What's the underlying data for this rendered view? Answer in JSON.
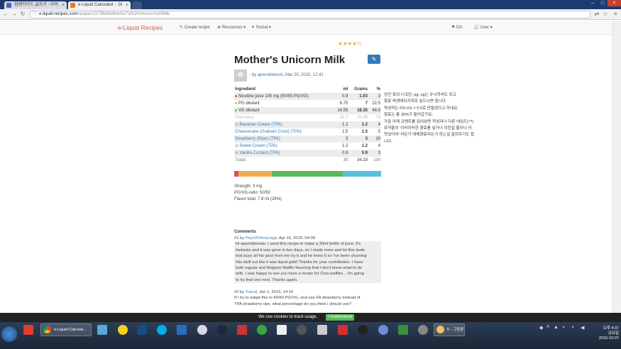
{
  "browser": {
    "tabs": [
      {
        "label": "힘쌘가이드 글쓰기 : 아이"
      },
      {
        "label": "e-Liquid Calculator :: Di"
      }
    ],
    "url_host": "e-liquid-recipes.com",
    "url_path": "/recipe/121795/Mother%27s%20Unicorn%20Milk"
  },
  "site": {
    "brand": "e-Liquid Recipes",
    "nav": {
      "create": "Create recipe",
      "resources": "Resources",
      "social": "Social",
      "da": "DA",
      "user": "User"
    }
  },
  "recipe": {
    "rating_stars": "★★★★½",
    "title": "Mother's Unicorn Milk",
    "byline_prefix": "- by",
    "author": "apwroblewski",
    "date": ", Mar 20, 2015, 12:41",
    "table": {
      "headers": {
        "ingredient": "Ingredient",
        "ml": "ml",
        "grams": "Grams",
        "pct": "%"
      },
      "base": [
        {
          "name": "Nicotine juice 100 mg (50/50 PG/VG)",
          "ml": "0.9",
          "g": "1.03",
          "pct": "3",
          "color": "#d9534f"
        },
        {
          "name": "PG dilutant",
          "ml": "6.75",
          "g": "7",
          "pct": "22.5",
          "color": "#f0ad4e"
        },
        {
          "name": "VG dilutant",
          "ml": "14.55",
          "g": "18.35",
          "pct": "48.5",
          "color": "#5cb85c"
        }
      ],
      "base_total": {
        "name": "Total base",
        "ml": "22.2",
        "g": "26.38",
        "pct": "74"
      },
      "flavors": [
        {
          "name": "Bavarian Cream (TPA)",
          "ml": "1.2",
          "g": "1.2",
          "pct": "4",
          "warn": true
        },
        {
          "name": "Cheesecake (Graham Crust) (TPA)",
          "ml": "1.5",
          "g": "1.5",
          "pct": "5",
          "warn": false
        },
        {
          "name": "Strawberry (Ripe) (TPA)",
          "ml": "3",
          "g": "3",
          "pct": "10",
          "warn": false
        },
        {
          "name": "Sweet Cream (TPA)",
          "ml": "1.2",
          "g": "1.2",
          "pct": "4",
          "warn": true
        },
        {
          "name": "Vanilla Custard (TPA)",
          "ml": "0.9",
          "g": "0.9",
          "pct": "3",
          "warn": true
        }
      ],
      "totals": {
        "name": "Totals",
        "ml": "30",
        "g": "34.18",
        "pct": "100"
      }
    },
    "bar_segments": [
      {
        "pct": 3,
        "color": "#d9534f"
      },
      {
        "pct": 22.5,
        "color": "#f0ad4e"
      },
      {
        "pct": 48.5,
        "color": "#5cb85c"
      },
      {
        "pct": 26,
        "color": "#5bc0de"
      }
    ],
    "stats": {
      "strength": "Strength: 3 mg",
      "ratio": "PG/VG-ratio: 50/50",
      "flavor": "Flavor total: 7.8 ml (26%)"
    },
    "notes": [
      "상단 표의 니코틴, pg, vg는 무시하셔도 되고",
      "향료 퍼센테이지대로 넣으시면 됩니다.",
      "작성자는 PG:VG = 5:5로 만들었다고 하네요.",
      "향료는 총 26%가 들어갑구요.",
      "가끔 아래 코멘트를 읽어보면 작성자나 다른 네임드(ㅋ)",
      "유저들이 '이러이러한 향료를 넣거나 이런걸 줄이니 더",
      "맛있더라' 라든가 대체향료라든가 하는걸 알려주기도 합",
      "니다."
    ]
  },
  "comments": {
    "heading": "Comments",
    "items": [
      {
        "num": "#1 by",
        "author": "Poyn2Ohmyvayp",
        "date": ", Apr 16, 2015, 04:08",
        "text": "Hi apwroblewski. I used this recipe to make a 30ml bottle of juice. It's\nfantastic and it was gone in two days, so I made more and let this dude\nthat buys all his juice from me try it and he loves it so I've been churning\nthis stuff out like it was liquid gold! Thanks for your contribution. I have\nboth regular and Belgium Waffle flavoring that I don't know what to do\nwith. I was happy to see you have a recipe for Cina-waffles... I'm going\nto try that one next. Thanks again."
      },
      {
        "num": "#2 by",
        "author": "Tripod",
        "date": ", Jun 1, 2015, 14:16",
        "text": "If i try to adapt this to 40/60 PG/VG, and use FA strawberry instead of\nTPA strawberry ripe, what percentage do you think i should use?"
      }
    ]
  },
  "cookie": {
    "text": "We use cookies to track usage.",
    "button": "I Understand"
  },
  "taskbar": {
    "chrome_task": "e-Liquid Calculat...",
    "paint_task": "5 - 그림판",
    "lang": "A",
    "time_ampm": "오후 4:37",
    "weekday": "금요일",
    "date": "2016-10-07"
  }
}
